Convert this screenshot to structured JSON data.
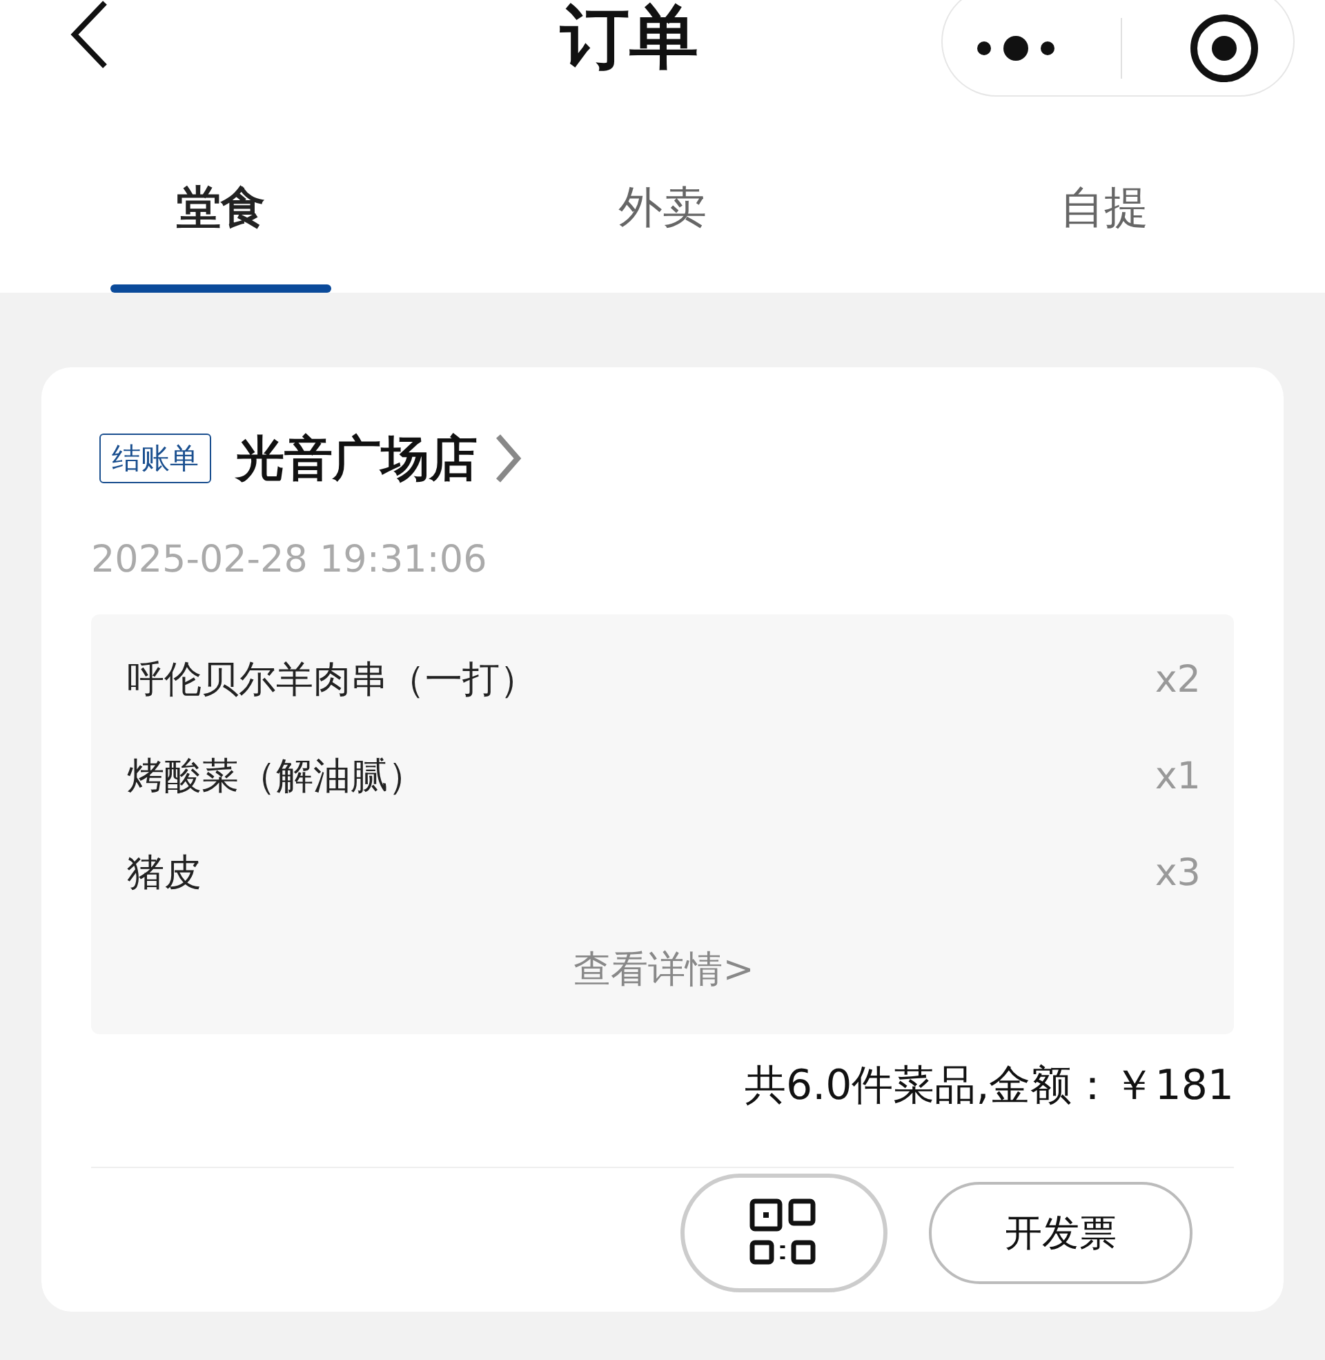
{
  "header": {
    "title": "订单"
  },
  "tabs": [
    {
      "label": "堂食",
      "selected": true
    },
    {
      "label": "外卖",
      "selected": false
    },
    {
      "label": "自提",
      "selected": false
    }
  ],
  "order": {
    "tag": "结账单",
    "store": "光音广场店",
    "time": "2025-02-28 19:31:06",
    "items": [
      {
        "name": "呼伦贝尔羊肉串（一打）",
        "qty": "x2"
      },
      {
        "name": "烤酸菜（解油腻）",
        "qty": "x1"
      },
      {
        "name": "猪皮",
        "qty": "x3"
      }
    ],
    "details_link": "查看详情>",
    "summary": "共6.0件菜品,金额：￥181",
    "buttons": [
      {
        "kind": "qr"
      },
      {
        "kind": "text",
        "label": "开发票"
      }
    ]
  }
}
